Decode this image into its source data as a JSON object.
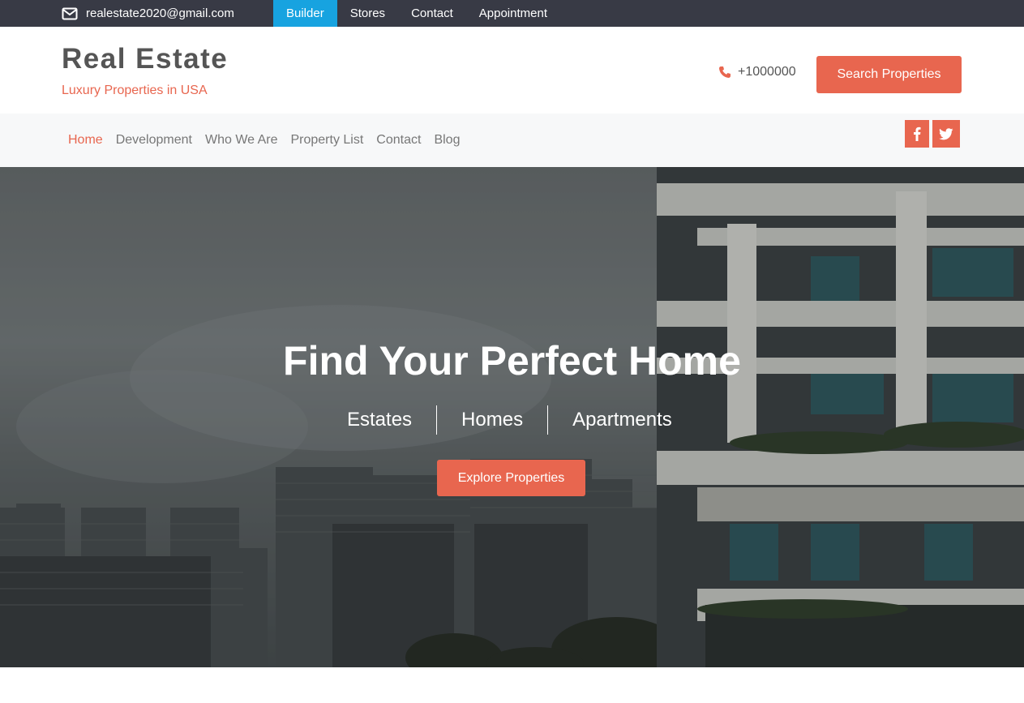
{
  "topbar": {
    "email": "realestate2020@gmail.com",
    "links": [
      {
        "label": "Builder",
        "active": true
      },
      {
        "label": "Stores",
        "active": false
      },
      {
        "label": "Contact",
        "active": false
      },
      {
        "label": "Appointment",
        "active": false
      }
    ]
  },
  "header": {
    "title": "Real Estate",
    "tagline": "Luxury Properties in USA",
    "phone": "+1000000",
    "search_button": "Search Properties"
  },
  "nav": {
    "items": [
      {
        "label": "Home",
        "active": true
      },
      {
        "label": "Development",
        "active": false
      },
      {
        "label": "Who We Are",
        "active": false
      },
      {
        "label": "Property List",
        "active": false
      },
      {
        "label": "Contact",
        "active": false
      },
      {
        "label": "Blog",
        "active": false
      }
    ],
    "social": [
      "facebook-icon",
      "twitter-icon"
    ]
  },
  "hero": {
    "title": "Find Your Perfect Home",
    "types": [
      "Estates",
      "Homes",
      "Apartments"
    ],
    "button": "Explore Properties"
  },
  "colors": {
    "accent": "#e8664f",
    "topbar": "#383a45",
    "active_top_link": "#17a3e0"
  }
}
